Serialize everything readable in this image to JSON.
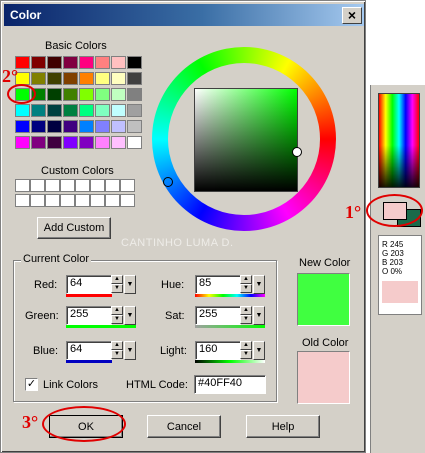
{
  "dialog": {
    "title": "Color",
    "close_glyph": "×",
    "basic_colors_label": "Basic Colors",
    "custom_colors_label": "Custom Colors",
    "add_custom_label": "Add Custom",
    "current_color_label": "Current Color",
    "new_color_label": "New Color",
    "old_color_label": "Old Color",
    "new_color_hex": "#40FF40",
    "old_color_hex": "#F5CBCB",
    "watermark": "CANTINHO LUMA D.",
    "fields": {
      "red": {
        "label": "Red:",
        "value": "64"
      },
      "green": {
        "label": "Green:",
        "value": "255"
      },
      "blue": {
        "label": "Blue:",
        "value": "64"
      },
      "hue": {
        "label": "Hue:",
        "value": "85"
      },
      "sat": {
        "label": "Sat:",
        "value": "255"
      },
      "light": {
        "label": "Light:",
        "value": "160"
      }
    },
    "link_colors_label": "Link Colors",
    "link_colors_checked": true,
    "html_code_label": "HTML Code:",
    "html_code_value": "#40FF40",
    "ok_label": "OK",
    "cancel_label": "Cancel",
    "help_label": "Help"
  },
  "basic_colors": [
    "#ff0000",
    "#800000",
    "#400000",
    "#800040",
    "#ff0080",
    "#ff8080",
    "#ffc0c0",
    "#000000",
    "#ffff00",
    "#808000",
    "#404000",
    "#804000",
    "#ff8000",
    "#ffff80",
    "#ffffc0",
    "#404040",
    "#00ff00",
    "#008000",
    "#004000",
    "#408000",
    "#80ff00",
    "#80ff80",
    "#c0ffc0",
    "#808080",
    "#00ffff",
    "#008080",
    "#004040",
    "#008040",
    "#00ff80",
    "#80ffc0",
    "#c0ffff",
    "#a0a0a0",
    "#0000ff",
    "#000080",
    "#000040",
    "#400080",
    "#0080ff",
    "#8080ff",
    "#c0c0ff",
    "#c0c0c0",
    "#ff00ff",
    "#800080",
    "#400040",
    "#8000ff",
    "#8000c0",
    "#ff80ff",
    "#ffc0ff",
    "#ffffff"
  ],
  "side_panel": {
    "swatch_hex": "#F5CBCB",
    "r": "R 245",
    "g": "G 203",
    "b": "B 203",
    "o": "O 0%"
  },
  "annotations": {
    "mark1": "1°",
    "mark2": "2°",
    "mark3": "3°",
    "accent": "#e00000"
  }
}
